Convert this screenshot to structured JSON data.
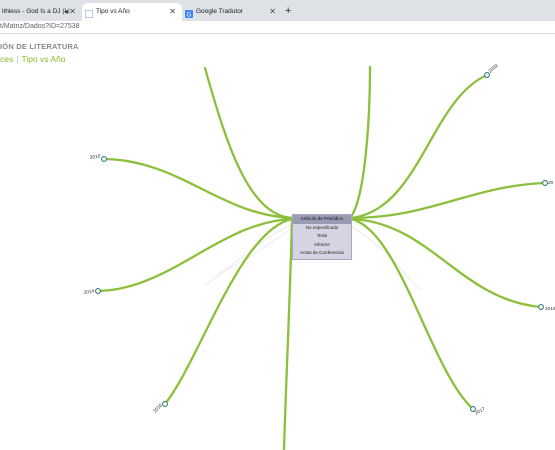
{
  "browser": {
    "tabs": [
      {
        "title": "ithless - God Is a DJ (Li",
        "active": false
      },
      {
        "title": "Tipo vs Año",
        "active": true
      },
      {
        "title": "Google Tradutor",
        "active": false
      }
    ],
    "new_tab_label": "+",
    "url": "t/Matriz/Dados?ID=27538"
  },
  "page": {
    "title": "IÓN DE LITERATURA",
    "breadcrumb": {
      "parent": "ces",
      "separator": "|",
      "current": "Tipo vs Año"
    }
  },
  "graph": {
    "center_items": [
      "Artículo de Periódico",
      "No especificado",
      "Tesis",
      "Informe",
      "Actas de Conferencia"
    ],
    "selected_item": "Artículo de Periódico",
    "year_nodes": [
      "2009",
      "2010",
      "20",
      "2014",
      "2015",
      "2016",
      "2017"
    ],
    "colors": {
      "link": "#8cbf3a",
      "menu_bg": "#d4d4e2",
      "menu_selected": "#9a9ab4"
    }
  }
}
